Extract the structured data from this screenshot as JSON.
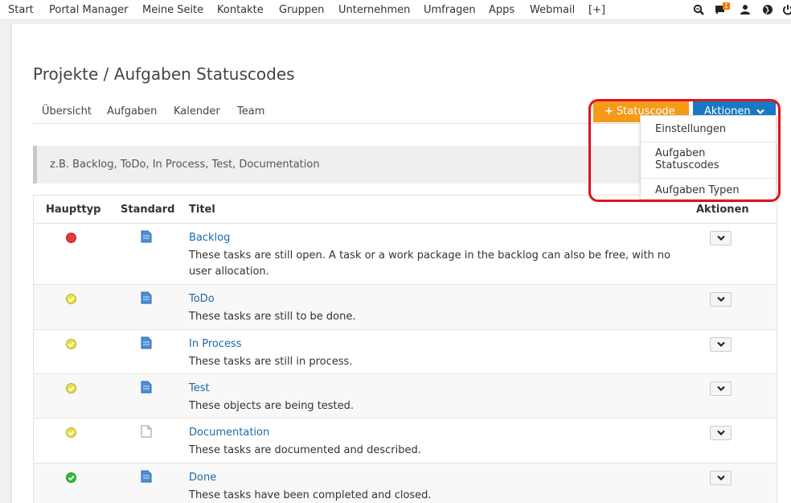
{
  "topnav": {
    "items": [
      "Start",
      "Portal Manager",
      "Meine Seite",
      "Kontakte",
      "Gruppen",
      "Unternehmen",
      "Umfragen",
      "Apps",
      "Webmail",
      "[+]"
    ],
    "notification_count": "1",
    "icons": [
      "zoom-icon",
      "chat-icon",
      "user-icon",
      "globe-icon",
      "power-icon"
    ]
  },
  "page": {
    "title": "Projekte / Aufgaben Statuscodes",
    "tabs": [
      "Übersicht",
      "Aufgaben",
      "Kalender",
      "Team"
    ],
    "add_button": "Statuscode",
    "actions_button": "Aktionen",
    "hint": "z.B. Backlog, ToDo, In Process, Test, Documentation"
  },
  "dropdown": {
    "items": [
      "Einstellungen",
      "Aufgaben Statuscodes",
      "Aufgaben Typen"
    ]
  },
  "table": {
    "headers": [
      "Haupttyp",
      "Standard",
      "Titel",
      "Aktionen"
    ],
    "rows": [
      {
        "title": "Backlog",
        "desc": "These tasks are still open. A task or a work package in the backlog can also be free, with no user allocation.",
        "status": "red",
        "doc": "blue"
      },
      {
        "title": "ToDo",
        "desc": "These tasks are still to be done.",
        "status": "yellow",
        "doc": "blue"
      },
      {
        "title": "In Process",
        "desc": "These tasks are still in process.",
        "status": "yellow",
        "doc": "blue"
      },
      {
        "title": "Test",
        "desc": "These objects are being tested.",
        "status": "yellow",
        "doc": "blue"
      },
      {
        "title": "Documentation",
        "desc": "These tasks are documented and described.",
        "status": "yellow",
        "doc": "blank"
      },
      {
        "title": "Done",
        "desc": "These tasks have been completed and closed.",
        "status": "green",
        "doc": "blue"
      }
    ]
  },
  "colors": {
    "orange": "#f59b1a",
    "blue": "#1779c3",
    "link": "#1b6aa8",
    "highlight": "#e0141e"
  }
}
